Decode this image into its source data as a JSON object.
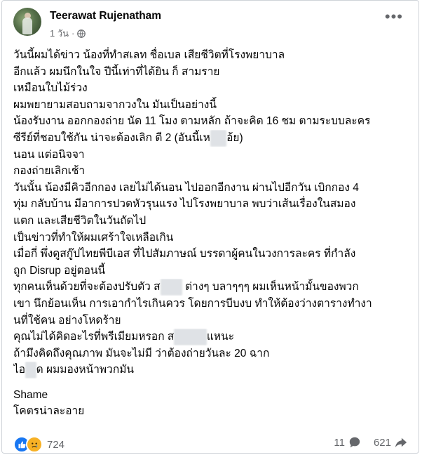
{
  "post": {
    "author": "Teerawat Rujenatham",
    "time": "1 วัน",
    "dot": "·",
    "lines": [
      "วันนี้ผมได้ข่าว น้องที่ทำสเลท ชื่อเบล เสียชีวิตที่โรงพยาบาล",
      "อีกแล้ว ผมนึกในใจ ปีนี้เท่าที่ได้ยิน ก็ สามราย",
      "เหมือนใบไม้ร่วง",
      "ผมพยายามสอบถามจากวงใน มันเป็นอย่างนี้",
      "น้องรับงาน ออกกองถ่าย นัด 11 โมง ตามหลัก ถ้าจะคิด 16 ชม ตามระบบละคร",
      "ซีรีย์ที่ชอบใช้กัน น่าจะต้องเลิก ตี 2 (อันนี้เห",
      "นอน แต่อนิจจา",
      "กองถ่ายเลิกเช้า",
      "วันนั้น น้องมีคิวอีกกอง เลยไม่ได้นอน ไปออกอีกงาน ผ่านไปอีกวัน เบิกกอง 4",
      "ทุ่ม กลับบ้าน มีอาการปวดหัวรุนแรง ไปโรงพยาบาล พบว่าเส้นเรื่องในสมอง",
      "แตก และเสียชีวิตในวันถัดไป",
      "เป็นข่าวที่ทำให้ผมเศร้าใจเหลือเกิน",
      "เมื่อกี่ พึ่งดูสกู๊ปไทยพีบีเอส ที่ไปสัมภาษณ์ บรรดาผู้คนในวงการละคร ที่กำลัง",
      "ถูก Disrup อยู่ตอนนี้",
      "ทุกคนเห็นด้วยที่จะต้องปรับตัว ส",
      "เขา นึกย้อนเห็น การเอากำไรเกินควร โดยการบีบงบ ทำให้ต้องว่างตารางทำงา",
      "นที่ใช้คน อย่างโหดร้าย",
      "คุณไม่ได้คิดอะไรที่พรีเมียมหรอก ส",
      "ถ้ามึงคิดถึงคุณภาพ มันจะไม่มี ว่าต้องถ่ายวันละ 20 ฉาก",
      "ไอ",
      "Shame",
      "โคตรน่าละอาย"
    ],
    "line5_tail": "อ้ย)",
    "line14_tail": "ต่างๆ บลาๆๆๆ ผมเห็นหน้ามั้นของพวก",
    "line17_tail": "แหนะ",
    "line19_tail": "ด ผมมองหน้าพวกมัน"
  },
  "footer": {
    "reaction_count": "724",
    "comment_count": "11",
    "share_count": "621"
  },
  "icons": {
    "globe": "globe-icon",
    "more": "more-options-icon",
    "like": "like-reaction-icon",
    "sad": "sad-reaction-icon",
    "comment": "comment-icon",
    "share": "share-icon"
  },
  "colors": {
    "text": "#050505",
    "meta": "#65676b",
    "like": "#1877f2",
    "sad": "#f7b125"
  }
}
